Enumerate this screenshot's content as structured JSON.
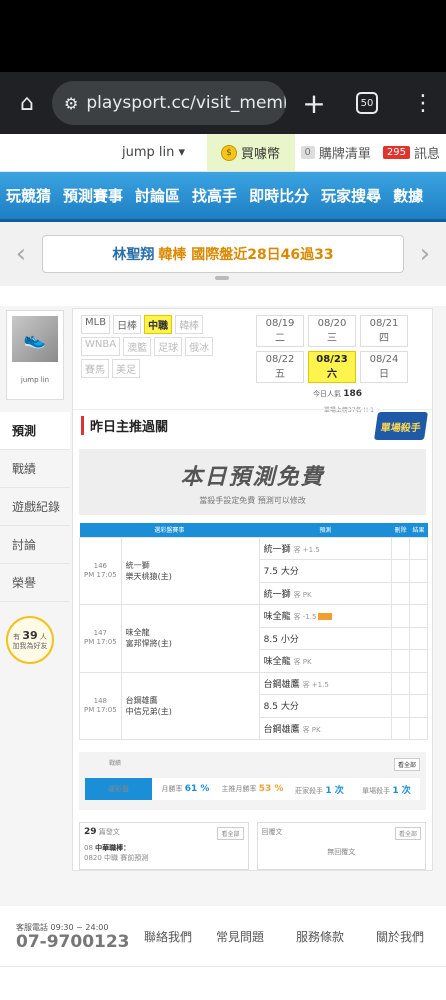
{
  "browser": {
    "url": "playsport.cc/visit_memb",
    "tab_count": "50"
  },
  "userbar": {
    "username": "jump lin ▾",
    "buy_label": "買噱幣",
    "cart_count": "0",
    "cart_label": "購牌清單",
    "msg_count": "295",
    "msg_label": "訊息"
  },
  "nav": [
    "玩競猜",
    "預測賽事",
    "討論區",
    "找高手",
    "即時比分",
    "玩家搜尋",
    "數據"
  ],
  "ticker": {
    "name": "林聖翔",
    "highlight": "韓棒 國際盤近28日46過33"
  },
  "profile": {
    "name": "jump lin",
    "likes_prefix": "有",
    "likes_count": "39",
    "likes_suffix": "人",
    "likes_note": "加我為好友"
  },
  "sidebar": [
    "預測",
    "戰績",
    "遊戲紀錄",
    "討論",
    "榮譽"
  ],
  "leagues": [
    {
      "label": "MLB",
      "state": "normal"
    },
    {
      "label": "日棒",
      "state": "normal"
    },
    {
      "label": "中職",
      "state": "on"
    },
    {
      "label": "韓棒",
      "state": "dim"
    },
    {
      "label": "WNBA",
      "state": "dim"
    },
    {
      "label": "澳籃",
      "state": "dim"
    },
    {
      "label": "足球",
      "state": "dim"
    },
    {
      "label": "俄冰",
      "state": "dim"
    },
    {
      "label": "賽馬",
      "state": "dim"
    },
    {
      "label": "美足",
      "state": "dim"
    }
  ],
  "dates": [
    {
      "label": "08/19 二",
      "state": "normal"
    },
    {
      "label": "08/20 三",
      "state": "normal"
    },
    {
      "label": "08/21 四",
      "state": "normal"
    },
    {
      "label": "08/22 五",
      "state": "normal"
    },
    {
      "label": "08/23 六",
      "state": "on"
    },
    {
      "label": "08/24 日",
      "state": "normal"
    }
  ],
  "popularity": {
    "label": "今日人氣",
    "value": "186"
  },
  "rank_text": "單場上榜37名 !! 1",
  "predictions": {
    "title": "昨日主推過關",
    "badge": "單場殺手",
    "free_big": "本日預測免費",
    "free_small": "當殺手設定免費 預測可以修改",
    "headers": [
      "選彩盤賽事",
      "預測",
      "刪除",
      "結果"
    ],
    "games": [
      {
        "no": "146",
        "time": "PM 17:05",
        "team1": "統一獅",
        "team2": "樂天桃猿(主)",
        "picks": [
          {
            "team": "統一獅",
            "opt": "客 +1.5"
          },
          {
            "team": "7.5 大分",
            "opt": ""
          },
          {
            "team": "統一獅",
            "opt": "客 PK"
          }
        ]
      },
      {
        "no": "147",
        "time": "PM 17:05",
        "team1": "味全龍",
        "team2": "富邦悍將(主)",
        "picks": [
          {
            "team": "味全龍",
            "opt": "客 -1.5"
          },
          {
            "team": "8.5 小分",
            "opt": ""
          },
          {
            "team": "味全龍",
            "opt": "客 PK"
          }
        ]
      },
      {
        "no": "148",
        "time": "PM 17:05",
        "team1": "台鋼雄鷹",
        "team2": "中信兄弟(主)",
        "picks": [
          {
            "team": "台鋼雄鷹",
            "opt": "客 +1.5"
          },
          {
            "team": "8.5 大分",
            "opt": ""
          },
          {
            "team": "台鋼雄鷹",
            "opt": "客 PK"
          }
        ]
      }
    ]
  },
  "stats": {
    "label": "戰績",
    "all_label": "看全部",
    "items": [
      {
        "label": "運彩盤",
        "value": ""
      },
      {
        "label": "月勝率",
        "value": "61 %"
      },
      {
        "label": "主推月勝率",
        "value": "53 %"
      },
      {
        "label": "莊家殺手",
        "value": "1 次"
      },
      {
        "label": "單場殺手",
        "value": "1 次"
      }
    ]
  },
  "posts": {
    "count": "29",
    "label": "篇發文",
    "more": "看全部",
    "date": "08",
    "title": "中華職棒：",
    "sub": "0820 中職 賽前預測",
    "reply_label": "回覆文",
    "reply_more": "看全部",
    "reply_empty": "無回覆文"
  },
  "footer": {
    "hours": "客服電話 09:30 ~ 24:00",
    "phone": "07-9700123",
    "links": [
      "聯絡我們",
      "常見問題",
      "服務條款",
      "關於我們"
    ]
  }
}
